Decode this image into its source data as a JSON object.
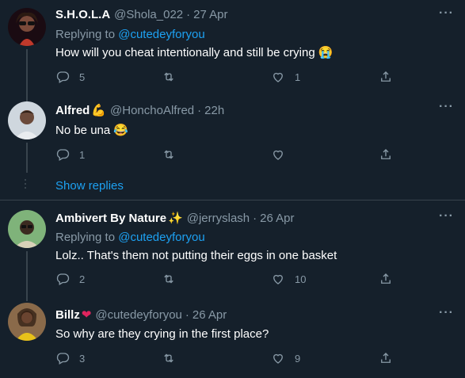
{
  "tweets": [
    {
      "name": "S.H.O.L.A",
      "name_emoji": "",
      "handle": "@Shola_022",
      "time": "27 Apr",
      "replying_prefix": "Replying to ",
      "replying_to": "@cutedeyforyou",
      "text": "How will you cheat intentionally and still be crying 😭",
      "replies": "5",
      "retweets": "",
      "likes": "1",
      "avatar_colors": [
        "#1a0b12",
        "#c0392b"
      ]
    },
    {
      "name": "Alfred",
      "name_emoji": "💪",
      "handle": "@HonchoAlfred",
      "time": "22h",
      "replying_prefix": "",
      "replying_to": "",
      "text": "No be una 😂",
      "replies": "1",
      "retweets": "",
      "likes": "",
      "avatar_colors": [
        "#cfd7de",
        "#6b4a3a"
      ]
    },
    {
      "name": "Ambivert By Nature",
      "name_emoji": "✨",
      "handle": "@jerryslash",
      "time": "26 Apr",
      "replying_prefix": "Replying to ",
      "replying_to": "@cutedeyforyou",
      "text": "Lolz.. That's them not putting their eggs in one basket",
      "replies": "2",
      "retweets": "",
      "likes": "10",
      "avatar_colors": [
        "#7fb37a",
        "#3b2a20"
      ]
    },
    {
      "name": "Billz",
      "name_emoji": "❤",
      "handle": "@cutedeyforyou",
      "time": "26 Apr",
      "replying_prefix": "",
      "replying_to": "",
      "text": "So why are they crying in the first place?",
      "replies": "3",
      "retweets": "",
      "likes": "9",
      "avatar_colors": [
        "#8a6a4a",
        "#e8c21a"
      ]
    }
  ],
  "dot": "·",
  "more_label": "···",
  "show_replies": "Show replies",
  "colors": {
    "background": "#15202b",
    "secondary_text": "#8899a6",
    "accent": "#1da1f2",
    "heart_emoji": "#e0245e"
  }
}
